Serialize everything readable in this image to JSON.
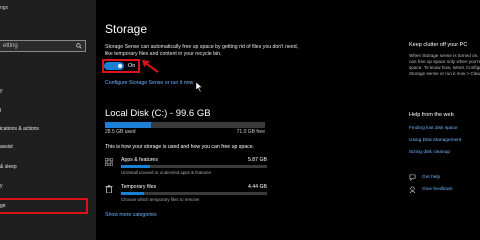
{
  "sidebar": {
    "home": "ngs",
    "search_placeholder": "etting",
    "items": [
      {
        "id": "b",
        "label": "y"
      },
      {
        "id": "l",
        "label": "l"
      },
      {
        "id": "notif",
        "label": "ications & actions"
      },
      {
        "id": "assist",
        "label": "assist"
      },
      {
        "id": "sleep",
        "label": "& sleep"
      },
      {
        "id": "battery",
        "label": "y"
      },
      {
        "id": "storage",
        "label": "ge"
      }
    ]
  },
  "main": {
    "title": "Storage",
    "description": "Storage Sense can automatically free up space by getting rid of files you don't need, like temporary files and content in your recycle bin.",
    "toggle_label": "On",
    "toggle_on": true,
    "configure_link": "Configure Storage Sense or run it now",
    "disk": {
      "title": "Local Disk (C:) - 99.6 GB",
      "used_label": "28.5 GB used",
      "free_label": "71.0 GB free",
      "used_fraction": 0.286,
      "how_text": "This is how your storage is used and how you can free up space."
    },
    "categories": [
      {
        "name": "Apps & features",
        "size": "5.87 GB",
        "subtitle": "Uninstall unused or undesired apps & features",
        "fraction": 0.2,
        "icon": "apps-icon"
      },
      {
        "name": "Temporary files",
        "size": "4.44 GB",
        "subtitle": "Choose which temporary files to remove",
        "fraction": 0.16,
        "icon": "trash-icon"
      }
    ],
    "more_link": "Show more categories"
  },
  "right": {
    "clutter_title": "Keep clutter off your PC",
    "clutter_text": "When Storage sense is turned on, Windows can free up space only when you're low on space. To know how, select Configure Storage sense or run it now > Clean now.",
    "web_title": "Help from the web",
    "web_links": [
      "Finding lost disk space",
      "Using Disk Management",
      "Sizing disk cleanup"
    ],
    "help_link": "Get help",
    "feedback_link": "Give feedback"
  },
  "colors": {
    "accent": "#1b7fd6",
    "highlight": "#d9141b",
    "link": "#6fb2ff"
  }
}
